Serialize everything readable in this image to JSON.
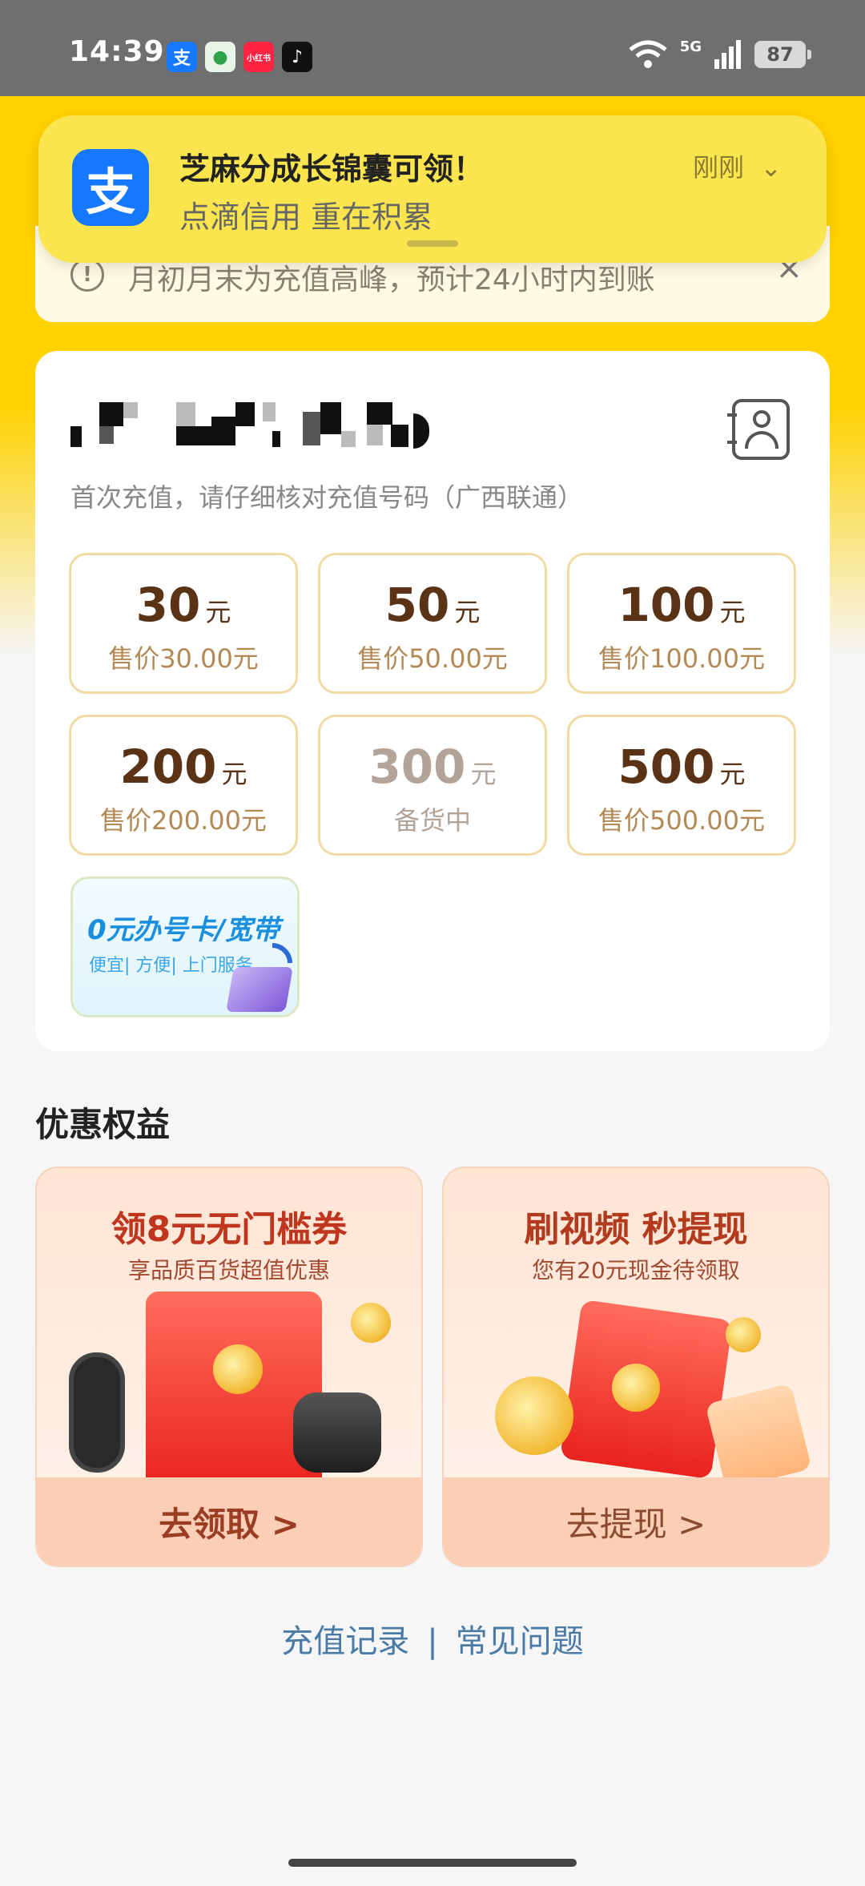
{
  "status_bar": {
    "time": "14:39",
    "apps": [
      {
        "icon": "alipay-icon",
        "glyph": "支",
        "color": "#1677ff"
      },
      {
        "icon": "green-app-icon",
        "glyph": "●",
        "color": "#2fa34a"
      },
      {
        "icon": "xiaohongshu-icon",
        "glyph": "小红书",
        "color": "#ff2442"
      },
      {
        "icon": "tiktok-icon",
        "glyph": "♪",
        "color": "#111111"
      }
    ],
    "network": "5G",
    "battery": "87"
  },
  "notification": {
    "app_icon_glyph": "支",
    "title": "芝麻分成长锦囊可领！",
    "subtitle": "点滴信用 重在积累",
    "time": "刚刚"
  },
  "tip": {
    "text": "月初月末为充值高峰，预计24小时内到账",
    "close": "×"
  },
  "recharge": {
    "hint": "首次充值，请仔细核对充值号码（广西联通）",
    "unit": "元",
    "options": [
      {
        "amount": "30",
        "price": "售价30.00元",
        "disabled": false
      },
      {
        "amount": "50",
        "price": "售价50.00元",
        "disabled": false
      },
      {
        "amount": "100",
        "price": "售价100.00元",
        "disabled": false
      },
      {
        "amount": "200",
        "price": "售价200.00元",
        "disabled": false
      },
      {
        "amount": "300",
        "price": "备货中",
        "disabled": true
      },
      {
        "amount": "500",
        "price": "售价500.00元",
        "disabled": false
      }
    ],
    "promo_tile": {
      "title": "0元办号卡/宽带",
      "subtitle": "便宜| 方便| 上门服务"
    }
  },
  "benefits": {
    "title": "优惠权益",
    "cards": [
      {
        "title": "领8元无门槛券",
        "subtitle": "享品质百货超值优惠",
        "action": "去领取 >"
      },
      {
        "title": "刷视频 秒提现",
        "subtitle": "您有20元现金待领取",
        "action": "去提现 >"
      }
    ]
  },
  "footer_links": {
    "history": "充值记录",
    "separator": "|",
    "faq": "常见问题"
  }
}
